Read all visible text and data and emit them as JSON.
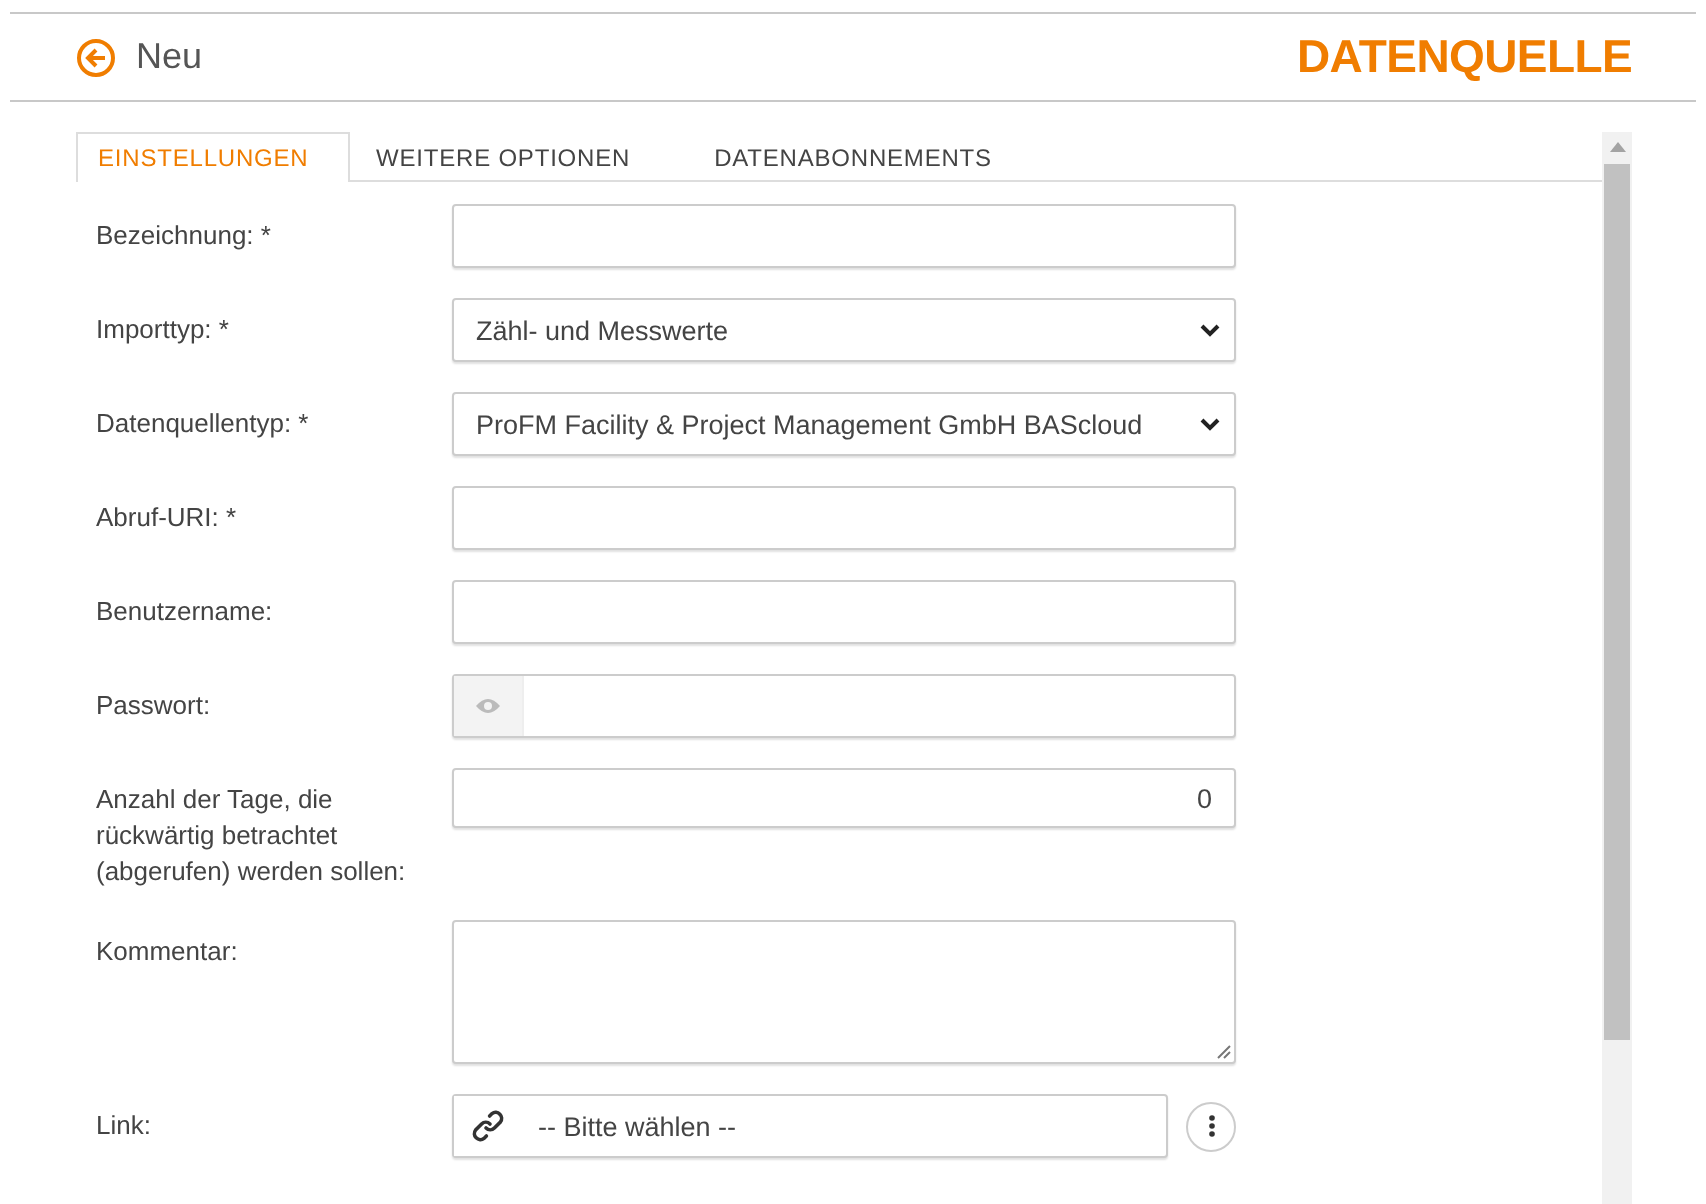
{
  "header": {
    "title": "Neu",
    "brand": "DATENQUELLE"
  },
  "tabs": [
    {
      "label": "EINSTELLUNGEN",
      "selected": true
    },
    {
      "label": "WEITERE OPTIONEN",
      "selected": false
    },
    {
      "label": "DATENABONNEMENTS",
      "selected": false
    }
  ],
  "fields": [
    {
      "label": "Bezeichnung: *",
      "kind": "text"
    },
    {
      "label": "Importtyp: *",
      "kind": "select",
      "value": "Zähl- und Messwerte"
    },
    {
      "label": "Datenquellentyp: *",
      "kind": "select",
      "value": "ProFM Facility & Project Management GmbH BAScloud"
    },
    {
      "label": "Abruf-URI: *",
      "kind": "text"
    },
    {
      "label": "Benutzername:",
      "kind": "text"
    },
    {
      "label": "Passwort:",
      "kind": "password"
    },
    {
      "label": "Anzahl der Tage, die rückwärtig betrachtet (abgerufen) werden sollen:",
      "kind": "number",
      "value": "0"
    },
    {
      "label": "Kommentar:",
      "kind": "textarea"
    },
    {
      "label": "Link:",
      "kind": "link",
      "value": "-- Bitte wählen --"
    }
  ]
}
